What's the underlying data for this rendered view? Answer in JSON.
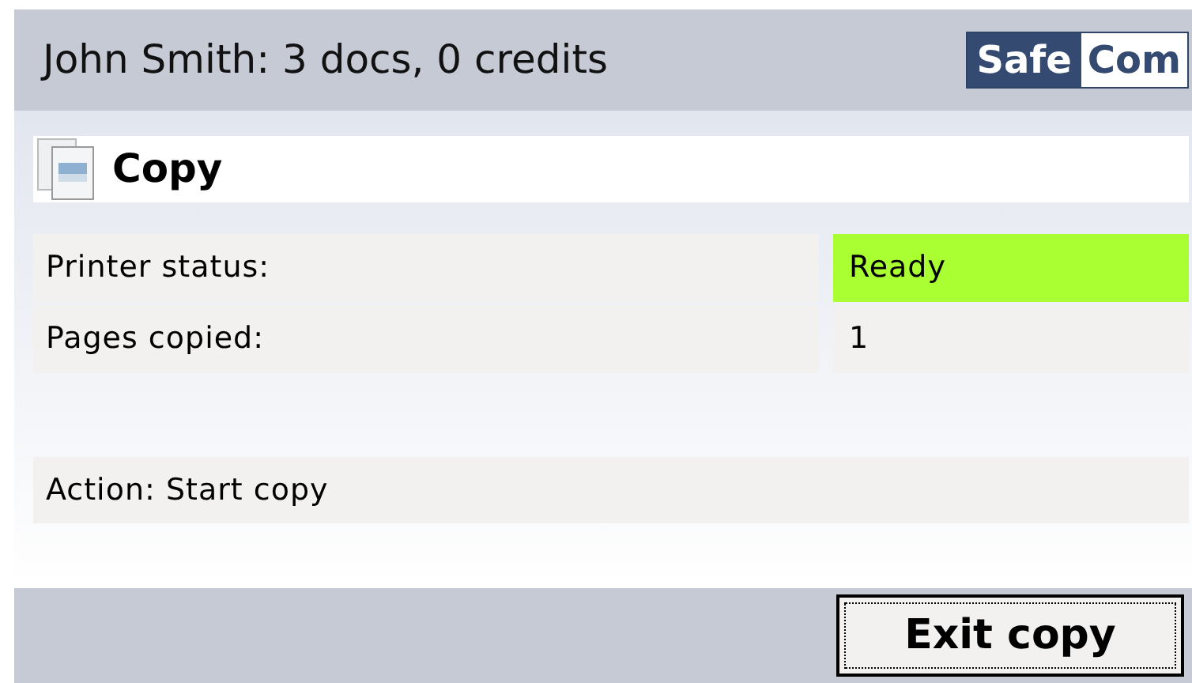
{
  "header": {
    "user_info": "John Smith: 3 docs, 0 credits",
    "logo": [
      "Safe",
      "Com"
    ]
  },
  "title": "Copy",
  "rows": [
    {
      "label": "Printer status:",
      "value": "Ready",
      "color": "#aaff33"
    },
    {
      "label": "Pages copied:",
      "value": "1",
      "color": "#f2f1f0"
    }
  ],
  "action": "Action: Start copy",
  "buttons": [
    {
      "label": "Exit copy",
      "focused": true
    }
  ]
}
